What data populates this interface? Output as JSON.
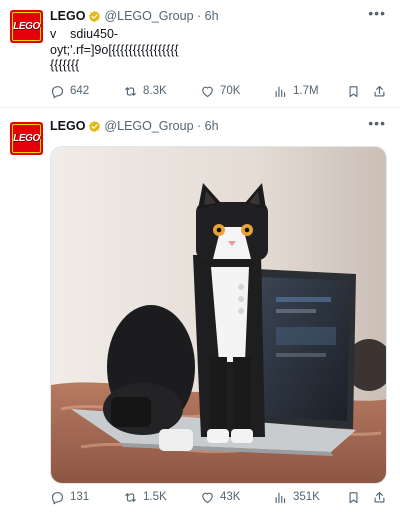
{
  "tweets": [
    {
      "author": {
        "name": "LEGO",
        "handle": "@LEGO_Group",
        "time": "6h",
        "avatar_text": "LEGO"
      },
      "text": "v    sdiu450-\noyt;'.rf=]9o[{{{{{{{{{{{{{{{{\n{{{{{{{",
      "stats": {
        "replies": "642",
        "retweets": "8.3K",
        "likes": "70K",
        "views": "1.7M"
      }
    },
    {
      "author": {
        "name": "LEGO",
        "handle": "@LEGO_Group",
        "time": "6h",
        "avatar_text": "LEGO"
      },
      "media": {
        "alt_icon": "photo-lego-cat"
      },
      "stats": {
        "replies": "131",
        "retweets": "1.5K",
        "likes": "43K",
        "views": "351K"
      }
    }
  ],
  "colors": {
    "brand_red": "#e3000b",
    "brand_yellow": "#ffd500",
    "verified_gold": "#e2b719",
    "muted": "#536471"
  },
  "icons": [
    "reply-icon",
    "retweet-icon",
    "like-icon",
    "views-icon",
    "bookmark-icon",
    "share-icon",
    "more-icon",
    "verified-badge-icon"
  ]
}
